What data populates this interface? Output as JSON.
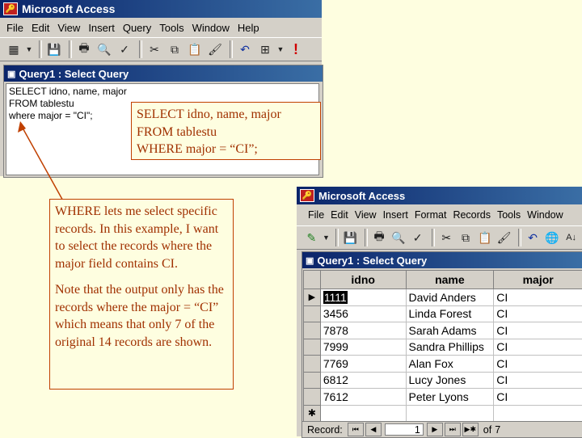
{
  "window1": {
    "title": "Microsoft Access",
    "menu": [
      "File",
      "Edit",
      "View",
      "Insert",
      "Query",
      "Tools",
      "Window",
      "Help"
    ],
    "query_title": "Query1 : Select Query",
    "sql_lines": [
      "SELECT idno, name, major",
      "FROM tablestu",
      "where major = \"CI\";"
    ]
  },
  "callout_sql": {
    "lines": [
      "SELECT idno, name, major",
      "FROM tablestu",
      "WHERE major = “CI”;"
    ]
  },
  "callout_note": {
    "paragraph1": "WHERE lets me select specific records. In this example, I want to select the records where the major field contains CI.",
    "paragraph2": "Note that the output only has the records where the major = “CI” which means that only 7 of the original 14 records are shown."
  },
  "window2": {
    "title": "Microsoft Access",
    "menu": [
      "File",
      "Edit",
      "View",
      "Insert",
      "Format",
      "Records",
      "Tools",
      "Window"
    ],
    "query_title": "Query1 : Select Query",
    "columns": [
      "idno",
      "name",
      "major"
    ],
    "rows": [
      [
        "1111",
        "David Anders",
        "CI"
      ],
      [
        "3456",
        "Linda Forest",
        "CI"
      ],
      [
        "7878",
        "Sarah Adams",
        "CI"
      ],
      [
        "7999",
        "Sandra Phillips",
        "CI"
      ],
      [
        "7769",
        "Alan Fox",
        "CI"
      ],
      [
        "6812",
        "Lucy Jones",
        "CI"
      ],
      [
        "7612",
        "Peter Lyons",
        "CI"
      ]
    ],
    "new_row_marker": "✱",
    "nav": {
      "label": "Record:",
      "current": "1",
      "of_label": "of",
      "total": "7"
    }
  }
}
